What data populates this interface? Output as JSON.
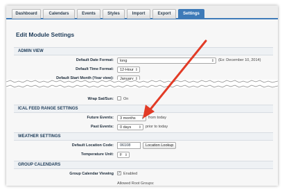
{
  "tabs": [
    {
      "label": "Dashboard",
      "active": false
    },
    {
      "label": "Calendars",
      "active": false
    },
    {
      "label": "Events",
      "active": false
    },
    {
      "label": "Styles",
      "active": false
    },
    {
      "label": "Import",
      "active": false
    },
    {
      "label": "Export",
      "active": false
    },
    {
      "label": "Settings",
      "active": true
    }
  ],
  "page_title": "Edit Module Settings",
  "admin_view": {
    "heading": "ADMIN VIEW",
    "date_format_label": "Default Date Format:",
    "date_format_value": "long",
    "date_format_note": "(Ex: December 10, 2014)",
    "time_format_label": "Default Time Format:",
    "time_format_value": "12-Hour",
    "start_month_label": "Default Start Month (Year view):",
    "start_month_value": "January"
  },
  "wrap": {
    "label": "Wrap Sat/Sun:",
    "value": "On"
  },
  "ical": {
    "heading": "ICAL FEED RANGE SETTINGS",
    "future_label": "Future Events:",
    "future_value": "3 months",
    "future_note": "from today",
    "past_label": "Past Events:",
    "past_value": "0 days",
    "past_note": "prior to today"
  },
  "weather": {
    "heading": "WEATHER SETTINGS",
    "location_label": "Default Location Code:",
    "location_value": "06108",
    "lookup_button": "Location Lookup",
    "unit_label": "Temperature Unit:",
    "unit_value": "F"
  },
  "group": {
    "heading": "GROUP CALENDARS",
    "viewing_label": "Group Calendar Viewing",
    "viewing_value": "Enabled",
    "allowed_label": "Allowed Root Groups:"
  },
  "colors": {
    "accent": "#3d7ab8",
    "arrow": "#e23b26"
  }
}
